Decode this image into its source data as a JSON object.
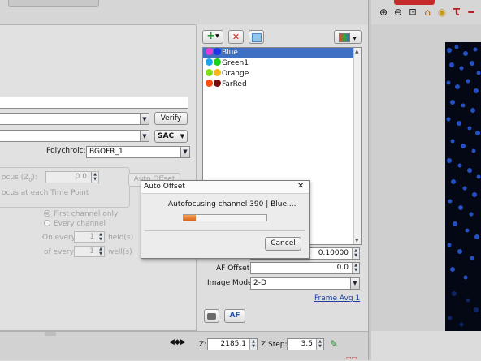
{
  "toolbar_top": {
    "icons": [
      "zoom-in-icon",
      "zoom-out-icon",
      "fit-icon",
      "home-icon",
      "lasso-icon",
      "measure-icon"
    ]
  },
  "left": {
    "verify_label": "Verify",
    "sac_label": "SAC",
    "polychroic_label": "Polychroic:",
    "polychroic_value": "BGOFR_1",
    "focus_label": "ocus (Z",
    "focus_sub": "0",
    "focus_suffix": "):",
    "focus_value": "0.0",
    "focus_each_label": "ocus at each Time Point",
    "auto_offset_btn": "Auto Offset",
    "first_channel": "First channel only",
    "every_channel": "Every channel",
    "on_every_label": "On every",
    "on_every_value": "1",
    "on_every_suffix": "field(s)",
    "of_every_label": "of every",
    "of_every_value": "1",
    "of_every_suffix": "well(s)"
  },
  "channels": {
    "items": [
      {
        "name": "Blue",
        "c1": "#e23bd8",
        "c2": "#1a35e6",
        "selected": true
      },
      {
        "name": "Green1",
        "c1": "#1ea5f0",
        "c2": "#1bd11b",
        "selected": false
      },
      {
        "name": "Orange",
        "c1": "#7ee01a",
        "c2": "#f5b814",
        "selected": false
      },
      {
        "name": "FarRed",
        "c1": "#ff4a10",
        "c2": "#7a0a0a",
        "selected": false
      }
    ]
  },
  "right_controls": {
    "offset_value": "0.10000",
    "af_offset_label": "AF Offset:",
    "af_offset_value": "0.0",
    "image_mode_label": "Image Mode:",
    "image_mode_value": "2-D",
    "frame_avg_link": "Frame Avg 1",
    "af_button": "AF"
  },
  "bottom": {
    "z_label": "Z:",
    "z_value": "2185.1",
    "zstep_label": "Z Step:",
    "zstep_value": "3.5"
  },
  "dialog": {
    "title": "Auto Offset",
    "message": "Autofocusing channel 390 | Blue....",
    "progress": 0.15,
    "cancel_label": "Cancel",
    "close_glyph": "✕"
  },
  "colors": {
    "accent_selection": "#3d6fc2",
    "progress_fill": "#e07a1f",
    "image_bg": "#040814"
  }
}
